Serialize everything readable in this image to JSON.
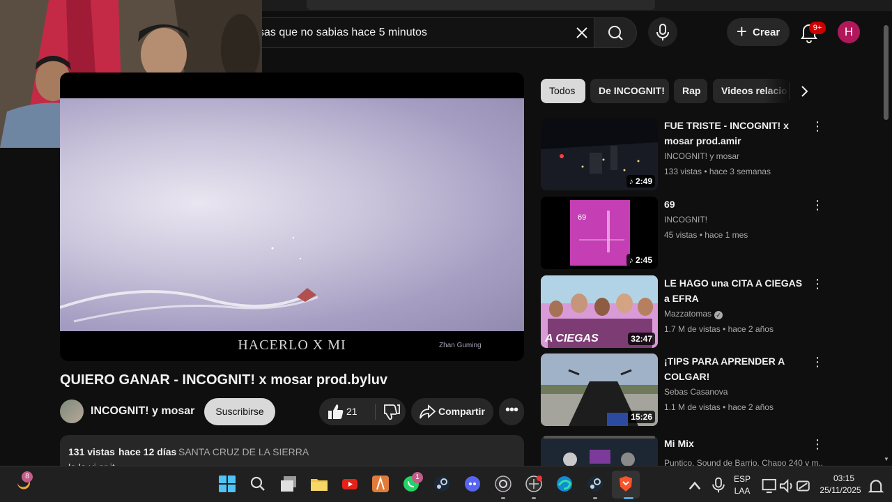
{
  "header": {
    "search_query": "sas que no sabias hace 5 minutos",
    "create_label": "Crear",
    "notifications_badge": "9+",
    "avatar_letter": "H"
  },
  "video": {
    "caption": "HACERLO X MI",
    "watermark": "Zhan Guming",
    "title": "QUIERO GANAR - INCOGNIT! x mosar prod.byluv",
    "channel": "INCOGNIT! y mosar",
    "subscribe_label": "Suscribirse",
    "likes": "21",
    "share_label": "Compartir",
    "views": "131 vistas",
    "age": "hace 12 días",
    "location": "SANTA CRUZ DE LA SIERRA",
    "description_partial": "la la vi er it..."
  },
  "chips": [
    "Todos",
    "De INCOGNIT!",
    "Rap",
    "Videos relacio"
  ],
  "related": [
    {
      "title": "FUE TRISTE - INCOGNIT! x mosar prod.amir",
      "channel": "INCOGNIT! y mosar",
      "meta": "133 vistas • hace 3 semanas",
      "duration": "2:49",
      "music": true
    },
    {
      "title": "69",
      "channel": "INCOGNIT!",
      "meta": "45 vistas • hace 1 mes",
      "duration": "2:45",
      "music": true,
      "thumb_text": "69"
    },
    {
      "title": "LE HAGO una CITA A CIEGAS a EFRA",
      "channel": "Mazzatomas",
      "meta": "1.7 M de vistas • hace 2 años",
      "duration": "32:47",
      "verified": true,
      "thumb_text": "A CIEGAS"
    },
    {
      "title": "¡TIPS PARA APRENDER A COLGAR!",
      "channel": "Sebas Casanova",
      "meta": "1.1 M de vistas • hace 2 años",
      "duration": "15:26"
    },
    {
      "title": "Mi Mix",
      "channel": "Puntico, Sound de Barrio, Chapo 240 y m...",
      "meta": "",
      "duration": ""
    }
  ],
  "taskbar": {
    "browser_badge": "8",
    "whatsapp_badge": "1",
    "lang_top": "ESP",
    "lang_bottom": "LAA",
    "time": "03:15",
    "date": "25/11/2025"
  },
  "colors": {
    "background": "#0f0f0f",
    "chip_active": "#d9d9d9",
    "notification_red": "#cc0000",
    "avatar": "#b0185a"
  }
}
